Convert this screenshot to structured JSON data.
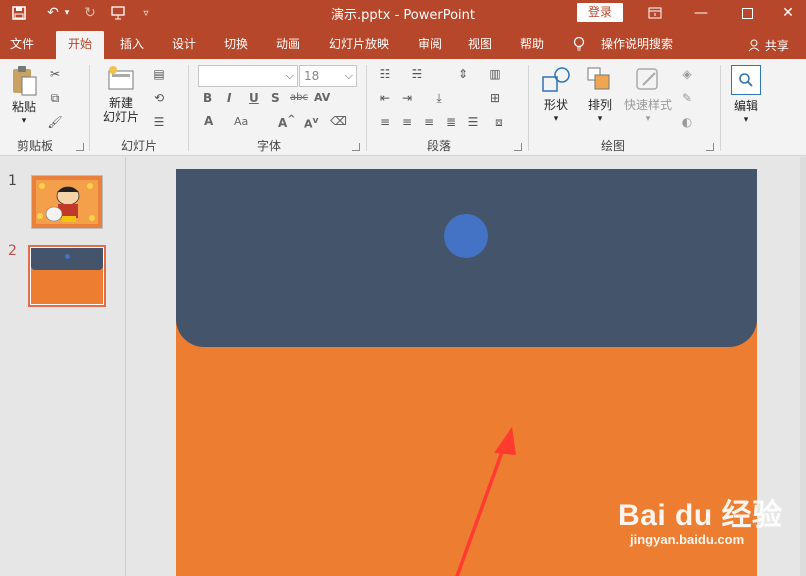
{
  "titlebar": {
    "title": "演示.pptx  -  PowerPoint",
    "login_label": "登录",
    "bg_color": "#b7472a"
  },
  "tabs": [
    {
      "label": "文件"
    },
    {
      "label": "开始",
      "active": true
    },
    {
      "label": "插入"
    },
    {
      "label": "设计"
    },
    {
      "label": "切换"
    },
    {
      "label": "动画"
    },
    {
      "label": "幻灯片放映"
    },
    {
      "label": "审阅"
    },
    {
      "label": "视图"
    },
    {
      "label": "帮助"
    },
    {
      "label": "操作说明搜索"
    }
  ],
  "share_label": "共享",
  "ribbon": {
    "clipboard": {
      "paste_label": "粘贴",
      "group_label": "剪贴板"
    },
    "slides": {
      "new_slide_label_1": "新建",
      "new_slide_label_2": "幻灯片",
      "group_label": "幻灯片"
    },
    "font": {
      "font_name": "",
      "font_size": "18",
      "group_label": "字体"
    },
    "paragraph": {
      "group_label": "段落"
    },
    "drawing": {
      "shapes_label": "形状",
      "arrange_label": "排列",
      "quick_styles_label": "快速样式",
      "group_label": "绘图"
    },
    "editing": {
      "editing_label": "编辑"
    }
  },
  "slides_pane": {
    "items": [
      {
        "number": "1"
      },
      {
        "number": "2",
        "selected": true
      }
    ]
  },
  "slide": {
    "bg_color": "#ed7d31",
    "band_color": "#44546a",
    "dot_color": "#4472c4"
  },
  "watermark": {
    "brand": "Bai du 经验",
    "url": "jingyan.baidu.com"
  }
}
